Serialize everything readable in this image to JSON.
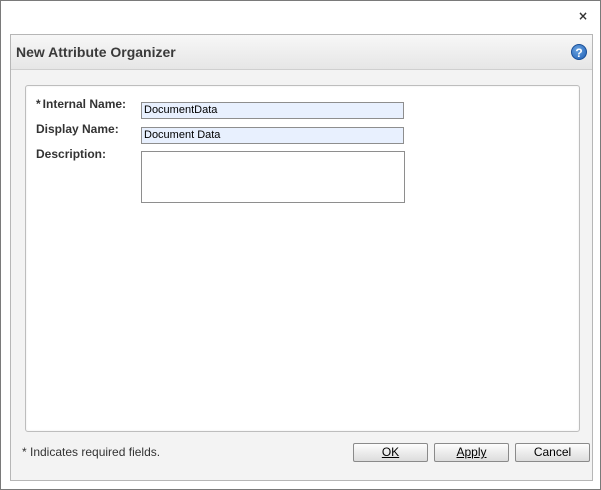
{
  "window": {
    "close_glyph": "×"
  },
  "dialog": {
    "title": "New Attribute Organizer",
    "help_glyph": "?"
  },
  "form": {
    "required_marker": "*",
    "internal_name": {
      "label": "Internal Name:",
      "value": "DocumentData",
      "required": true
    },
    "display_name": {
      "label": "Display Name:",
      "value": "Document Data"
    },
    "description": {
      "label": "Description:",
      "value": ""
    }
  },
  "footer": {
    "note": "* Indicates required fields.",
    "ok_label": "OK",
    "apply_label": "Apply",
    "cancel_label": "Cancel"
  },
  "icons": {
    "close": "close-icon",
    "help": "help-icon"
  },
  "colors": {
    "input_fill": "#e8f0fe",
    "help_icon": "#1f5fb5",
    "title_text": "#3a3a3a"
  }
}
